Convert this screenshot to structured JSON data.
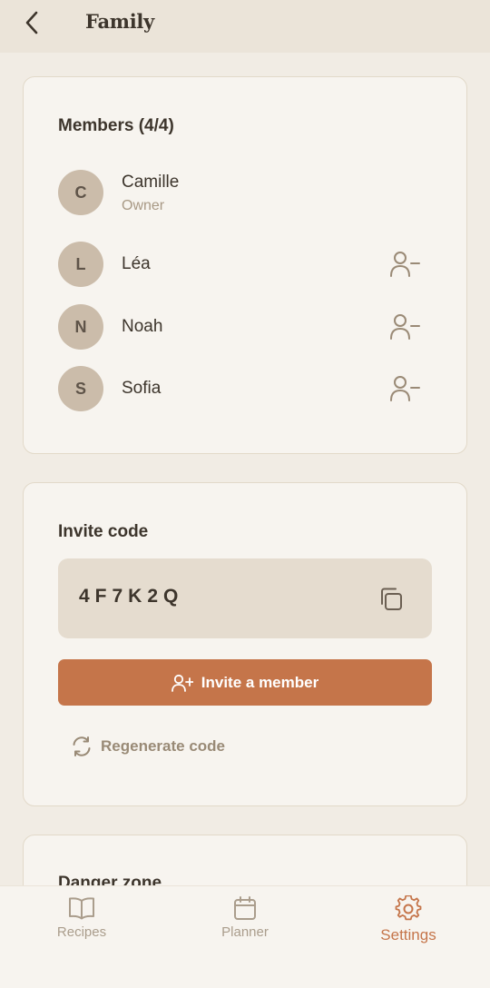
{
  "header": {
    "title": "Family",
    "back_icon": "chevron-left-icon"
  },
  "members_card": {
    "title": "Members (4/4)",
    "members": [
      {
        "initial": "C",
        "name": "Camille",
        "role": "Owner"
      },
      {
        "initial": "L",
        "name": "Léa",
        "action_icon": "user-minus-icon"
      },
      {
        "initial": "N",
        "name": "Noah",
        "action_icon": "user-minus-icon"
      },
      {
        "initial": "S",
        "name": "Sofia",
        "action_icon": "user-minus-icon"
      }
    ]
  },
  "invite_card": {
    "title": "Invite code",
    "code": "4F7K2Q",
    "copy_icon": "copy-icon",
    "invite_button": {
      "label": "Invite a member",
      "icon": "user-plus-icon"
    },
    "regenerate_button": {
      "label": "Regenerate code",
      "icon": "refresh-icon"
    }
  },
  "danger_card": {
    "title": "Danger zone"
  },
  "bottom_nav": {
    "items": [
      {
        "label": "Recipes",
        "icon": "book-icon",
        "active": false
      },
      {
        "label": "Planner",
        "icon": "calendar-icon",
        "active": false
      },
      {
        "label": "Settings",
        "icon": "gear-icon",
        "active": true
      }
    ]
  },
  "colors": {
    "background": "#f1ece4",
    "card": "#f7f4ef",
    "accent": "#c5754a",
    "text": "#3d352c",
    "muted": "#a89985",
    "avatar": "#cbbcaa"
  }
}
